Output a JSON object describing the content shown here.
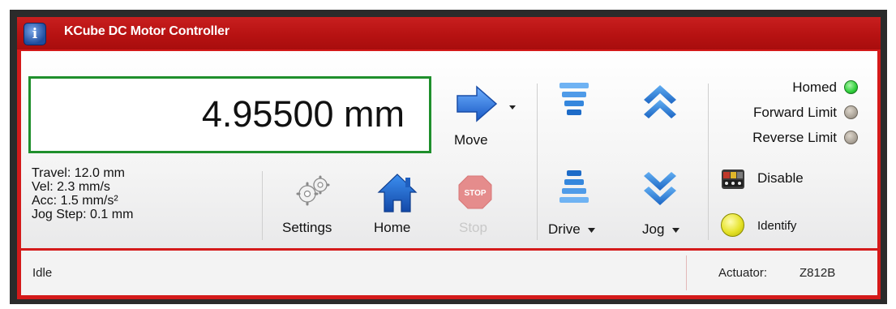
{
  "window": {
    "title": "KCube DC Motor Controller"
  },
  "position": {
    "value": "4.95500 mm"
  },
  "info": {
    "travel": "Travel: 12.0 mm",
    "vel": "Vel: 2.3 mm/s",
    "acc": "Acc: 1.5 mm/s²",
    "jog_step": "Jog Step: 0.1 mm"
  },
  "buttons": {
    "move": "Move",
    "settings": "Settings",
    "home": "Home",
    "stop": "Stop",
    "stop_sign": "STOP",
    "drive": "Drive",
    "jog": "Jog",
    "disable": "Disable",
    "identify": "Identify"
  },
  "indicators": [
    {
      "label": "Homed",
      "color": "#2fcf3a"
    },
    {
      "label": "Forward Limit",
      "color": "#a8a095"
    },
    {
      "label": "Reverse Limit",
      "color": "#a8a095"
    }
  ],
  "status": {
    "text": "Idle",
    "actuator_label": "Actuator:",
    "actuator_value": "Z812B"
  },
  "colors": {
    "title_red": "#b71212",
    "accent_blue": "#2e74d6",
    "display_border_green": "#1f8f2c"
  }
}
